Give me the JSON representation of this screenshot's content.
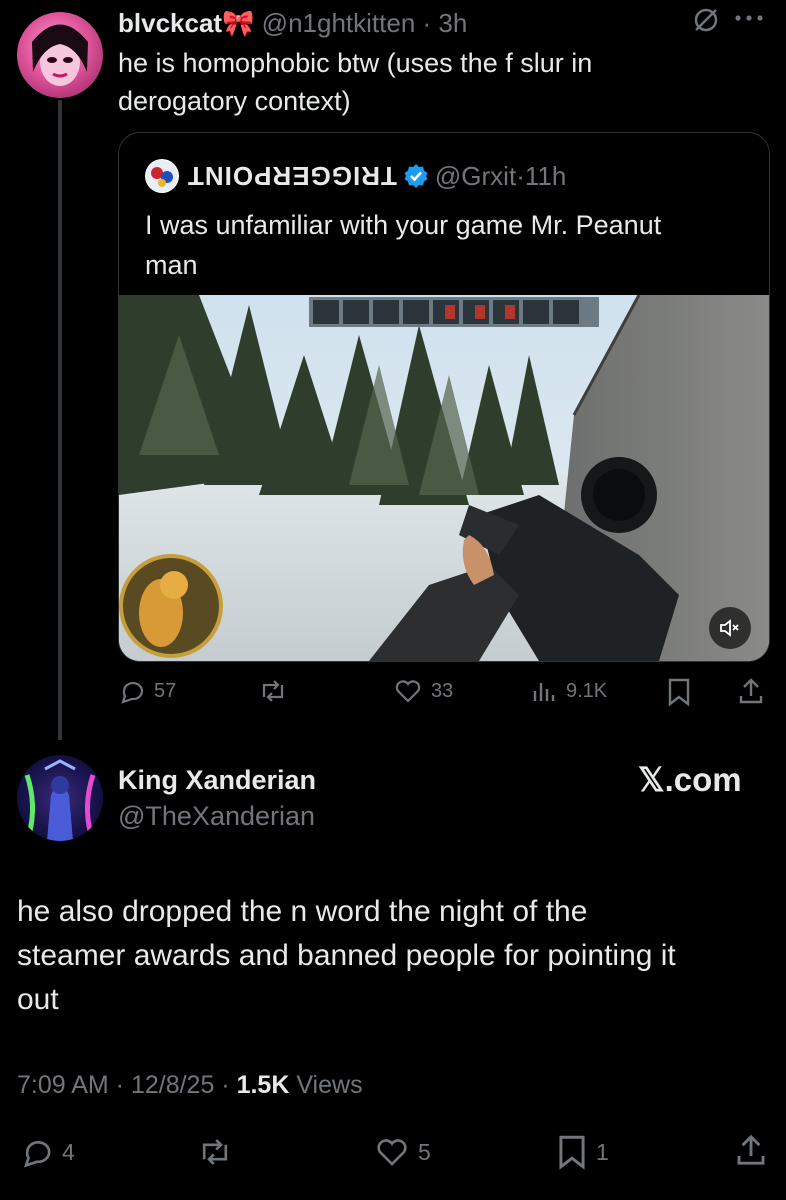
{
  "tweet1": {
    "display_name": "blvckcat🎀",
    "handle": "@n1ghtkitten",
    "time": "3h",
    "text_line1": "he is homophobic btw (uses the f slur in",
    "text_line2": "derogatory context)",
    "stats": {
      "replies": "57",
      "likes": "33",
      "views": "9.1K"
    }
  },
  "quote": {
    "display_name": "TRIGGERPOINT",
    "handle": "@Grxit",
    "time": "11h",
    "text_line1": "I was unfamiliar with your game Mr. Peanut",
    "text_line2": "man"
  },
  "tweet2": {
    "display_name": "King Xanderian",
    "handle": "@TheXanderian",
    "watermark": "𝕏.com",
    "text_line1": "he also dropped the n word the night of the",
    "text_line2": "steamer awards and banned people for pointing it",
    "text_line3": "out",
    "timestamp": "7:09 AM · 12/8/25 · ",
    "views_count": "1.5K",
    "views_label": " Views",
    "stats": {
      "replies": "4",
      "likes": "5",
      "bookmarks": "1"
    }
  },
  "colors": {
    "background": "#000000",
    "text": "#e7e9ea",
    "muted": "#71767b",
    "verified": "#1d9bf0"
  },
  "icons": [
    "mute-icon",
    "more-icon",
    "verified-badge-icon",
    "reply-icon",
    "repost-icon",
    "like-icon",
    "views-icon",
    "bookmark-icon",
    "share-icon",
    "volume-muted-icon"
  ]
}
